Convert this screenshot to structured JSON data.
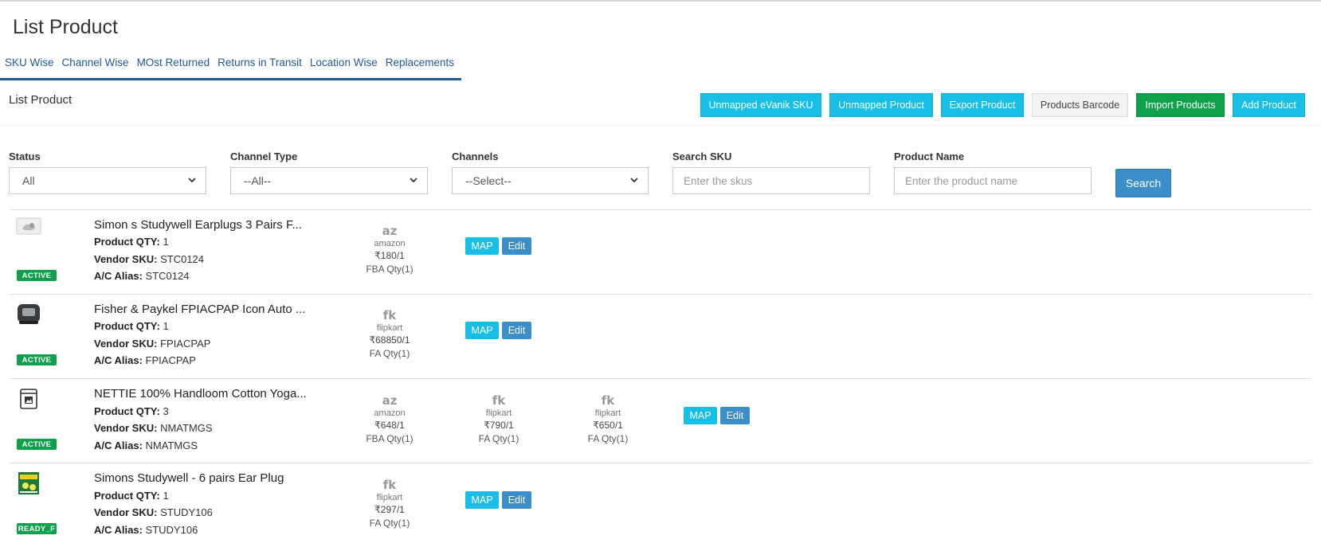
{
  "page_title": "List Product",
  "tabs": [
    {
      "label": "SKU Wise"
    },
    {
      "label": "Channel Wise"
    },
    {
      "label": "MOst Returned"
    },
    {
      "label": "Returns in Transit"
    },
    {
      "label": "Location Wise"
    },
    {
      "label": "Replacements"
    }
  ],
  "section_title": "List Product",
  "actions": {
    "unmapped_evanik_sku": "Unmapped eVanik SKU",
    "unmapped_product": "Unmapped Product",
    "export_product": "Export Product",
    "products_barcode": "Products Barcode",
    "import_products": "Import Products",
    "add_product": "Add Product"
  },
  "filters": {
    "status": {
      "label": "Status",
      "value": "All"
    },
    "channel_type": {
      "label": "Channel Type",
      "value": "--All--"
    },
    "channels": {
      "label": "Channels",
      "value": "--Select--"
    },
    "search_sku": {
      "label": "Search SKU",
      "placeholder": "Enter the skus"
    },
    "product_name": {
      "label": "Product Name",
      "placeholder": "Enter the product name"
    },
    "search_button": "Search"
  },
  "field_labels": {
    "qty": "Product QTY:",
    "vendor_sku": "Vendor SKU:",
    "alias": "A/C Alias:"
  },
  "buttons": {
    "map": "MAP",
    "edit": "Edit"
  },
  "products": [
    {
      "name": "Simon s Studywell Earplugs 3 Pairs F...",
      "qty": "1",
      "vendor_sku": "STC0124",
      "alias": "STC0124",
      "status": "ACTIVE",
      "image_icon": "earplug-product-icon",
      "channels": [
        {
          "logo": "az",
          "name": "amazon",
          "price": "₹180/1",
          "qty": "FBA Qty(1)"
        }
      ]
    },
    {
      "name": "Fisher & Paykel FPIACPAP Icon Auto ...",
      "qty": "1",
      "vendor_sku": "FPIACPAP",
      "alias": "FPIACPAP",
      "status": "ACTIVE",
      "image_icon": "cpap-device-icon",
      "channels": [
        {
          "logo": "fk",
          "name": "flipkart",
          "price": "₹68850/1",
          "qty": "FA Qty(1)"
        }
      ]
    },
    {
      "name": "NETTIE 100% Handloom Cotton Yoga...",
      "qty": "3",
      "vendor_sku": "NMATMGS",
      "alias": "NMATMGS",
      "status": "ACTIVE",
      "image_icon": "image-placeholder-icon",
      "channels": [
        {
          "logo": "az",
          "name": "amazon",
          "price": "₹648/1",
          "qty": "FBA Qty(1)"
        },
        {
          "logo": "fk",
          "name": "flipkart",
          "price": "₹790/1",
          "qty": "FA Qty(1)"
        },
        {
          "logo": "fk",
          "name": "flipkart",
          "price": "₹650/1",
          "qty": "FA Qty(1)"
        }
      ]
    },
    {
      "name": "Simons Studywell - 6 pairs Ear Plug",
      "qty": "1",
      "vendor_sku": "STUDY106",
      "alias": "STUDY106",
      "status": "READY_F",
      "image_icon": "earplug-pack-icon",
      "channels": [
        {
          "logo": "fk",
          "name": "flipkart",
          "price": "₹297/1",
          "qty": "FA Qty(1)"
        }
      ]
    }
  ]
}
